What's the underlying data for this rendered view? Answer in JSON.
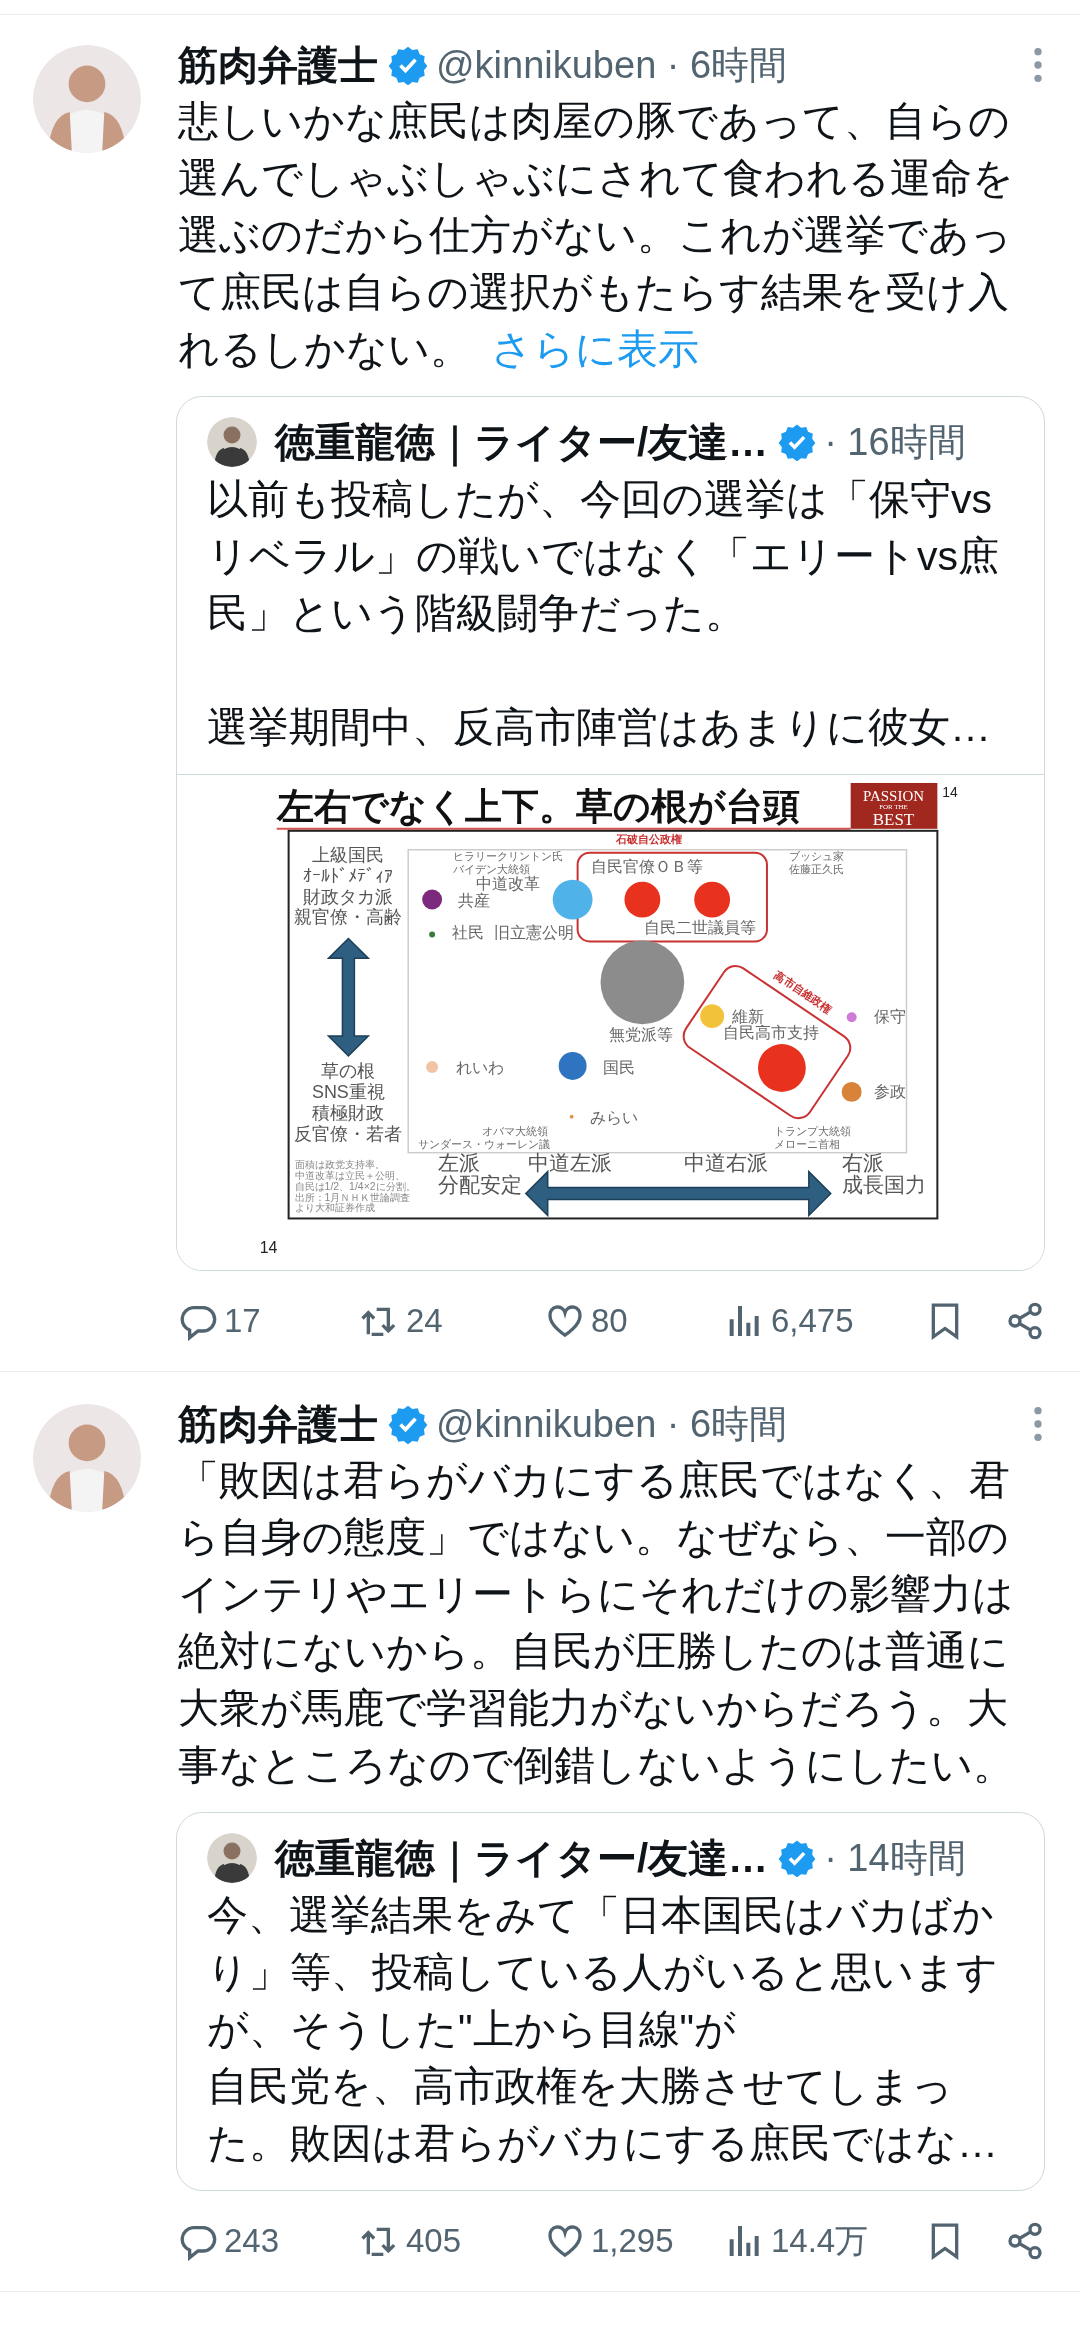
{
  "tweets": [
    {
      "author": {
        "name": "筋肉弁護士",
        "verified": true,
        "meta": "@kinnikuben · 6時間"
      },
      "text": "悲しいかな庶民は肉屋の豚であって、自らの選んでしゃぶしゃぶにされて食われる運命を選ぶのだから仕方がない。これが選挙であって庶民は自らの選択がもたらす結果を受け入れるしかない。",
      "show_more": "さらに表示",
      "quote": {
        "name": "徳重龍徳｜ライター/友達…",
        "verified": true,
        "meta": "· 16時間",
        "paragraphs": [
          "以前も投稿したが、今回の選挙は「保守vsリベラル」の戦いではなく「エリートvs庶民」という階級闘争だった。",
          "選挙期間中、反高市陣営はあまりに彼女…"
        ],
        "slide": {
          "title": "左右でなく上下。草の根が台頭",
          "logo": [
            "PASSION",
            "FOR THE",
            "BEST"
          ],
          "page_number": "14",
          "corner_number": "14",
          "upper_side": [
            "上級国民",
            "ｵｰﾙﾄﾞﾒﾃﾞｨｱ",
            "財政タカ派",
            "親官僚・高齢"
          ],
          "lower_side": [
            "草の根",
            "SNS重視",
            "積極財政",
            "反官僚・若者"
          ],
          "note": [
            "面積は政党支持率。",
            "中道改革は立民＋公明、",
            "自民は1/2、1/4×2に分割。",
            "出所：1月ＮＨＫ世論調査",
            "より大和証券作成"
          ],
          "axis_labels": [
            "左派",
            "分配安定",
            "中道左派",
            "中道右派",
            "右派",
            "成長国力"
          ],
          "bubbles": [
            {
              "color": "#7b2a7e"
            },
            {
              "color": "#3d7a3a"
            },
            {
              "color": "#4fb3ea"
            },
            {
              "color": "#e8321e"
            },
            {
              "color": "#e8321e"
            },
            {
              "color": "#8c8c8c"
            },
            {
              "color": "#f2c23a"
            },
            {
              "color": "#d07ad8"
            },
            {
              "color": "#e8321e"
            },
            {
              "color": "#f2c4a6"
            },
            {
              "color": "#2f74c0"
            },
            {
              "color": "#d9823a"
            },
            {
              "color": "#e09a50"
            }
          ],
          "labels": [
            {
              "text": "石破自公政権",
              "kind": "group"
            },
            {
              "text": "ヒラリークリントン氏",
              "kind": "small"
            },
            {
              "text": "ブッシュ家",
              "kind": "small"
            },
            {
              "text": "バイデン大統領",
              "kind": "small"
            },
            {
              "text": "自民官僚ＯＢ等",
              "kind": "normal"
            },
            {
              "text": "佐藤正久氏",
              "kind": "small"
            },
            {
              "text": "中道改革",
              "kind": "normal"
            },
            {
              "text": "共産",
              "kind": "normal"
            },
            {
              "text": "社民",
              "kind": "normal"
            },
            {
              "text": "旧立憲公明",
              "kind": "normal"
            },
            {
              "text": "自民二世議員等",
              "kind": "normal"
            },
            {
              "text": "高市自維政権",
              "kind": "group"
            },
            {
              "text": "維新",
              "kind": "normal"
            },
            {
              "text": "保守",
              "kind": "normal"
            },
            {
              "text": "無党派等",
              "kind": "normal"
            },
            {
              "text": "自民高市支持",
              "kind": "normal"
            },
            {
              "text": "れいわ",
              "kind": "normal"
            },
            {
              "text": "国民",
              "kind": "normal"
            },
            {
              "text": "参政",
              "kind": "normal"
            },
            {
              "text": "みらい",
              "kind": "normal"
            },
            {
              "text": "オバマ大統領",
              "kind": "small"
            },
            {
              "text": "トランプ大統領",
              "kind": "small"
            },
            {
              "text": "サンダース・ウォーレン議",
              "kind": "small"
            },
            {
              "text": "メローニ首相",
              "kind": "small"
            }
          ]
        }
      },
      "actions": [
        {
          "kind": "reply",
          "count": "17"
        },
        {
          "kind": "repost",
          "count": "24"
        },
        {
          "kind": "like",
          "count": "80"
        },
        {
          "kind": "views",
          "count": "6,475"
        },
        {
          "kind": "bookmark"
        },
        {
          "kind": "share"
        }
      ]
    },
    {
      "author": {
        "name": "筋肉弁護士",
        "verified": true,
        "meta": "@kinnikuben · 6時間"
      },
      "text": "「敗因は君らがバカにする庶民ではなく、君ら自身の態度」ではない。なぜなら、一部のインテリやエリートらにそれだけの影響力は絶対にないから。自民が圧勝したのは普通に大衆が馬鹿で学習能力がないからだろう。大事なところなので倒錯しないようにしたい。",
      "quote": {
        "name": "徳重龍徳｜ライター/友達…",
        "verified": true,
        "meta": "· 14時間",
        "paragraphs": [
          "今、選挙結果をみて「日本国民はバカばかり」等、投稿している人がいると思いますが、そうした\"上から目線\"が",
          "自民党を、高市政権を大勝させてしまった。敗因は君らがバカにする庶民ではな…"
        ]
      },
      "actions": [
        {
          "kind": "reply",
          "count": "243"
        },
        {
          "kind": "repost",
          "count": "405"
        },
        {
          "kind": "like",
          "count": "1,295"
        },
        {
          "kind": "views",
          "count": "14.4万"
        },
        {
          "kind": "bookmark"
        },
        {
          "kind": "share"
        }
      ]
    }
  ]
}
